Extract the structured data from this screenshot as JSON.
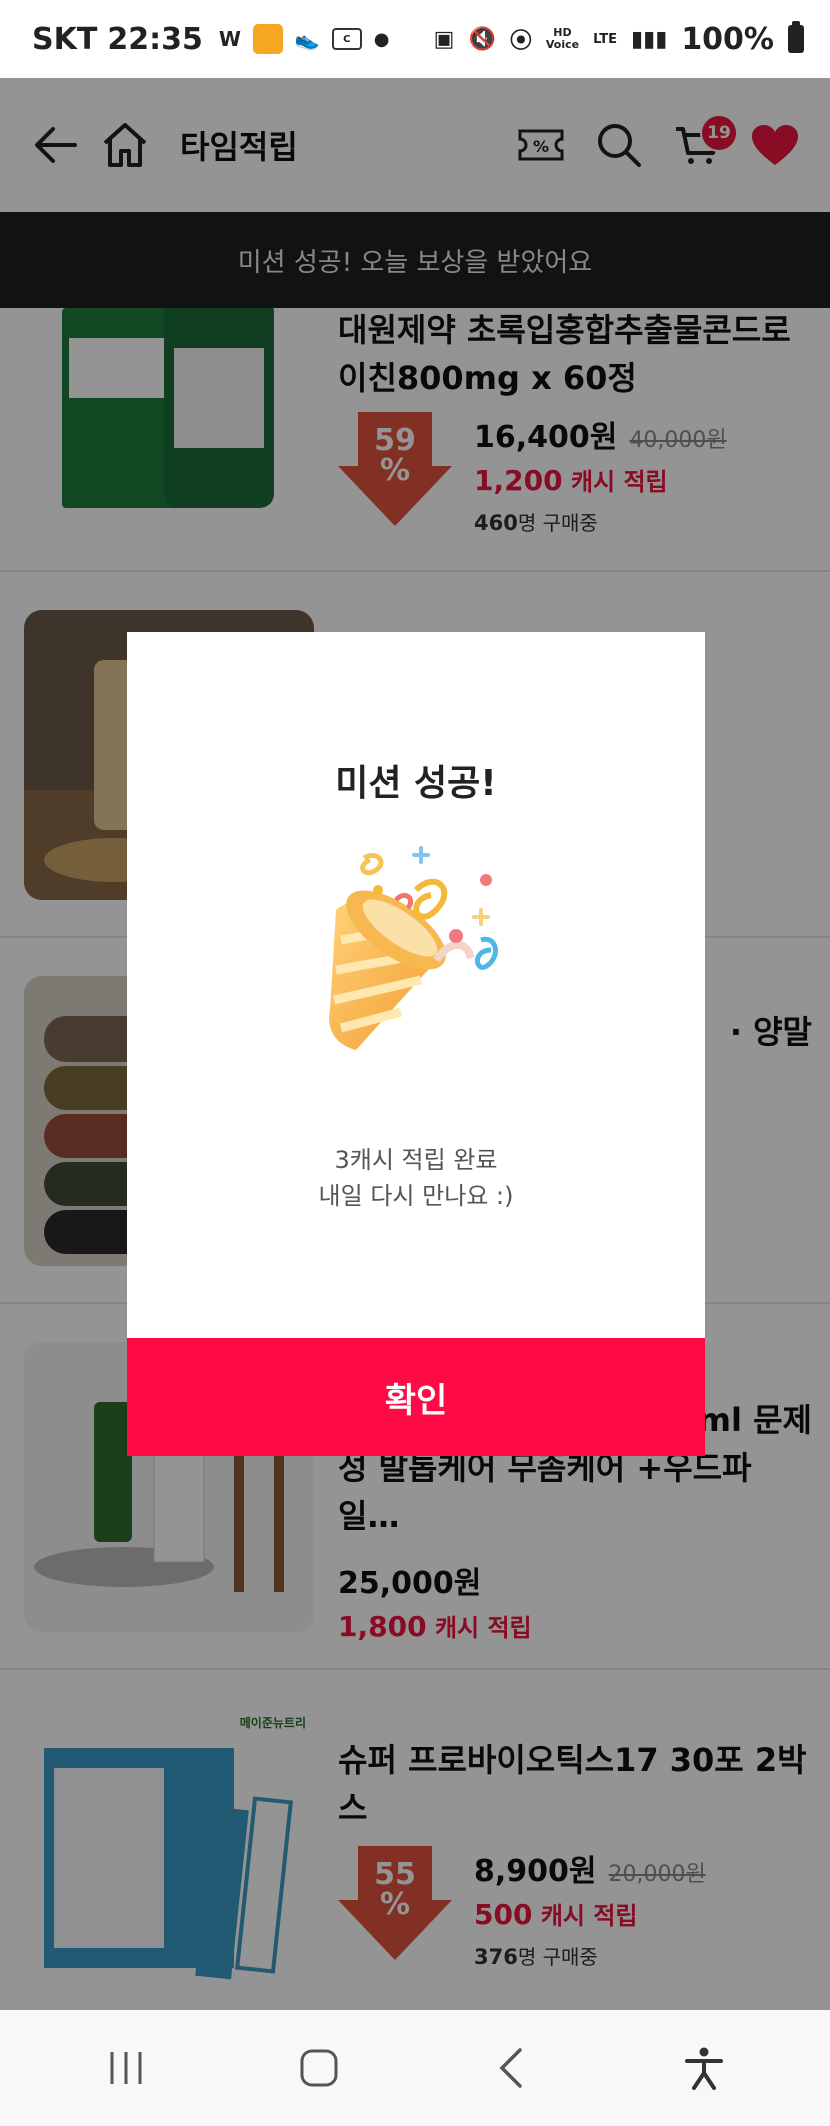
{
  "status_bar": {
    "carrier": "SKT",
    "time": "22:35",
    "battery": "100%",
    "net_label_top": "HD",
    "net_label_bottom": "Voice",
    "lte": "LTE"
  },
  "header": {
    "title": "타임적립",
    "cart_count": "19",
    "icons": [
      "back-arrow-icon",
      "home-icon",
      "coupon-icon",
      "search-icon",
      "cart-icon",
      "heart-icon"
    ],
    "coupon_glyph": "%"
  },
  "toast": {
    "message": "미션 성공! 오늘 보상을 받았어요"
  },
  "products": [
    {
      "name": "대원제약 초록입홍합추출물콘드로이친800mg x 60정",
      "discount_num": "59",
      "discount_sign": "%",
      "price": "16,400원",
      "original_price": "40,000원",
      "cash_amount": "1,200",
      "cash_label": "캐시 적립",
      "sold_count": "460",
      "sold_label": "명 구매중"
    },
    {
      "name": "",
      "price": "",
      "cash_amount": "",
      "cash_label": ""
    },
    {
      "name_fragment": "· 양말"
    },
    {
      "name_fragment": "ml 문제",
      "name_line2": "성 발톱케어 무좀케어 +우드파일…",
      "price": "25,000원",
      "cash_amount": "1,800",
      "cash_label": "캐시 적립"
    },
    {
      "brand": "메이준뉴트리",
      "name": "슈퍼 프로바이오틱스17 30포 2박스",
      "discount_num": "55",
      "discount_sign": "%",
      "price": "8,900원",
      "original_price": "20,000원",
      "cash_amount": "500",
      "cash_label": "캐시 적립",
      "sold_count": "376",
      "sold_label": "명 구매중"
    }
  ],
  "modal": {
    "title": "미션 성공!",
    "message_line1": "3캐시 적립 완료",
    "message_line2": "내일 다시 만나요 :)",
    "confirm_label": "확인"
  },
  "colors": {
    "accent": "#ff0a45",
    "cash_red": "#e8163e",
    "toast_bg": "#1e2024",
    "discount_red": "#e0533f"
  },
  "nav_bar": {
    "icons": [
      "recent-apps-icon",
      "home-nav-icon",
      "back-nav-icon",
      "accessibility-icon"
    ]
  }
}
